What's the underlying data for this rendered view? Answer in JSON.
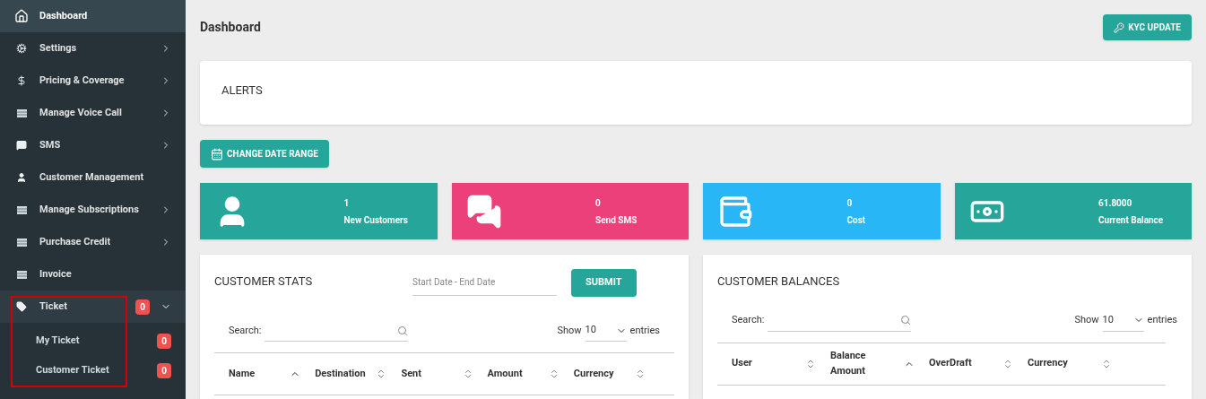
{
  "sidebar": {
    "items": [
      {
        "label": "Dashboard",
        "kind": "home",
        "selected": true
      },
      {
        "label": "Settings",
        "kind": "cogs",
        "selected": false,
        "expanded": false
      },
      {
        "label": "Pricing & Coverage",
        "kind": "dollar",
        "selected": false,
        "expanded": false
      },
      {
        "label": "Manage Voice Call",
        "kind": "list",
        "selected": false,
        "expanded": false
      },
      {
        "label": "SMS",
        "kind": "chat",
        "selected": false,
        "expanded": false
      },
      {
        "label": "Customer Management",
        "kind": "user",
        "selected": false
      },
      {
        "label": "Manage Subscriptions",
        "kind": "list",
        "selected": false,
        "expanded": false
      },
      {
        "label": "Purchase Credit",
        "kind": "list",
        "selected": false,
        "expanded": false
      },
      {
        "label": "Invoice",
        "kind": "list",
        "selected": false
      },
      {
        "label": "Ticket",
        "kind": "tag",
        "selected": false,
        "expanded": true,
        "badge": "0",
        "highlighted": true,
        "children": [
          {
            "label": "My Ticket",
            "badge": "0",
            "selected": false
          },
          {
            "label": "Customer Ticket",
            "badge": "0",
            "selected": false
          }
        ]
      }
    ]
  },
  "header": {
    "title": "Dashboard",
    "button": "KYC UPDATE"
  },
  "alerts": {
    "title": "ALERTS"
  },
  "date_range_button": "CHANGE DATE RANGE",
  "stats": [
    {
      "value": "1",
      "label": "New Customers",
      "kind": "user",
      "color": "#26a69a"
    },
    {
      "value": "0",
      "label": "Send SMS",
      "kind": "chat",
      "color": "#ec407a"
    },
    {
      "value": "0",
      "label": "Cost",
      "kind": "wallet",
      "color": "#29b6f6"
    },
    {
      "value": "61.8000",
      "label": "Current Balance",
      "kind": "money",
      "color": "#26a69a"
    }
  ],
  "customer_stats": {
    "title": "CUSTOMER STATS",
    "date_placeholder": "Start Date - End Date",
    "submit": "SUBMIT",
    "search_label": "Search:",
    "show_label": "Show",
    "page_size": "10",
    "entries_label": "entries",
    "columns": [
      {
        "label": "Name",
        "sorted": true
      },
      {
        "label": "Destination",
        "sorted": false
      },
      {
        "label": "Sent",
        "sorted": false
      },
      {
        "label": "Amount",
        "sorted": false
      },
      {
        "label": "Currency",
        "sorted": false
      }
    ]
  },
  "customer_balances": {
    "title": "CUSTOMER BALANCES",
    "search_label": "Search:",
    "show_label": "Show",
    "page_size": "10",
    "entries_label": "entries",
    "columns": [
      {
        "label": "User",
        "sorted": false
      },
      {
        "label": "Balance Amount",
        "sorted": true
      },
      {
        "label": "OverDraft",
        "sorted": false
      },
      {
        "label": "Currency",
        "sorted": false
      }
    ]
  }
}
